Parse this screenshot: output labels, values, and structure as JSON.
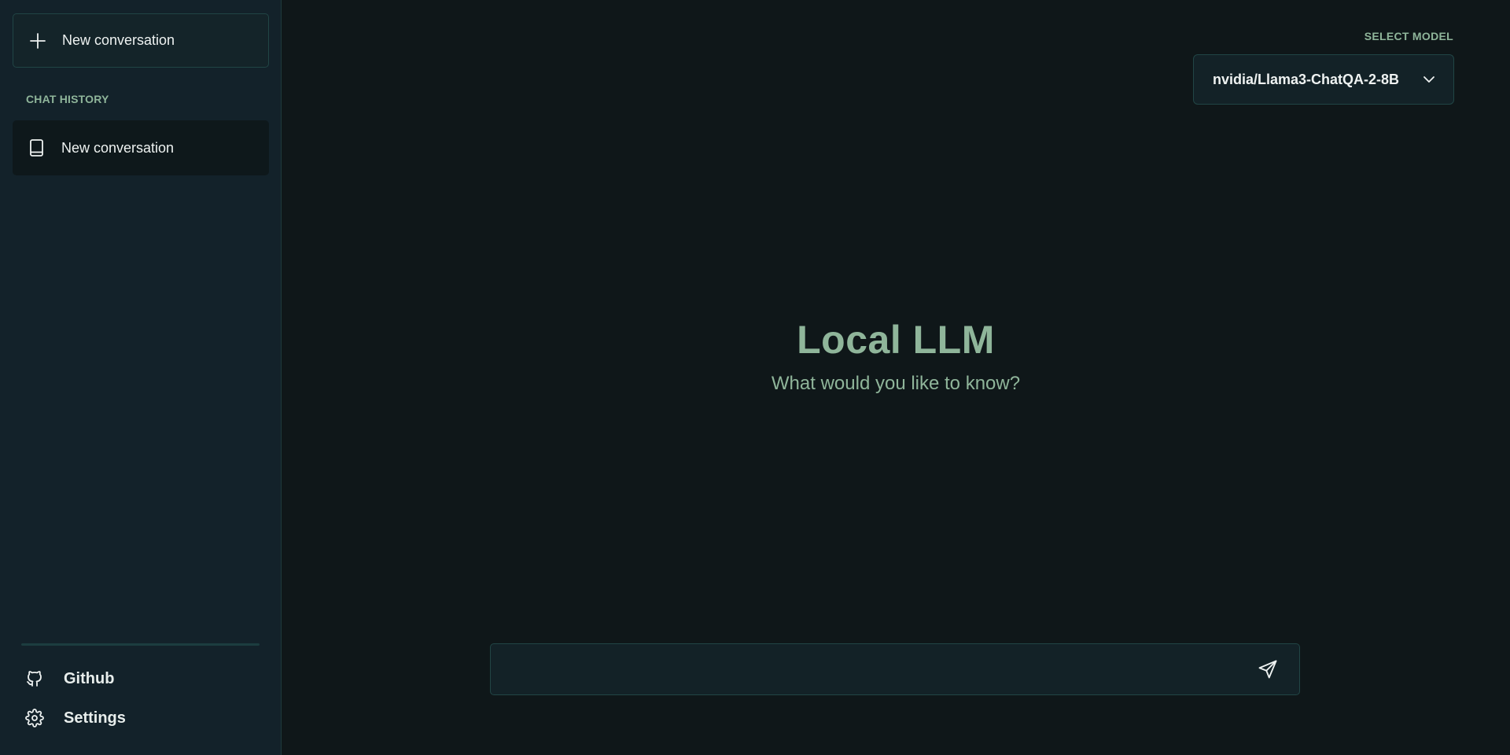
{
  "sidebar": {
    "new_conversation_label": "New conversation",
    "section_label": "CHAT HISTORY",
    "history": [
      {
        "label": "New conversation",
        "icon": "book-icon"
      }
    ],
    "footer": {
      "github_label": "Github",
      "settings_label": "Settings"
    }
  },
  "header": {
    "select_model_label": "SELECT MODEL",
    "model_value": "nvidia/Llama3-ChatQA-2-8B"
  },
  "hero": {
    "title": "Local LLM",
    "subtitle": "What would you like to know?"
  },
  "composer": {
    "value": "",
    "placeholder": ""
  },
  "icons": {
    "plus": "plus-icon",
    "book": "book-icon",
    "github": "github-icon",
    "settings": "gear-icon",
    "chevron": "chevron-down-icon",
    "send": "send-icon"
  },
  "colors": {
    "background": "#0f1719",
    "sidebar": "#13222a",
    "accent": "#8fb59a",
    "border": "#214545",
    "text": "#eef2f1"
  }
}
